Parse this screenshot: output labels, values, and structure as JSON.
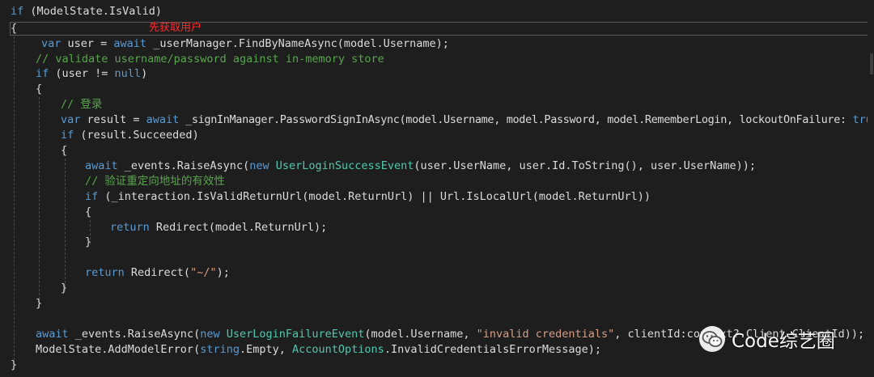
{
  "colors": {
    "background": "#1e1e1e",
    "keyword": "#569cd6",
    "type": "#4ec9b0",
    "comment": "#57a64a",
    "string": "#d69d85",
    "plain": "#dcdcdc",
    "annotation": "#ff2a2a"
  },
  "annotation": "先获取用户",
  "watermark": {
    "icon": "wechat-icon",
    "text": "Code综艺圈"
  },
  "code": {
    "l01": {
      "kw1": "if",
      "rest": " (ModelState.IsValid)"
    },
    "l02": {
      "text": "{"
    },
    "l03": {
      "kw1": "var",
      "mid": " user = ",
      "kw2": "await",
      "rest": " _userManager.FindByNameAsync(model.Username);"
    },
    "l04": {
      "comment": "// validate username/password against in-memory store"
    },
    "l05": {
      "kw1": "if",
      "mid": " (user != ",
      "kw2": "null",
      "rest": ")"
    },
    "l06": {
      "text": "{"
    },
    "l07": {
      "comment": "// 登录"
    },
    "l08": {
      "kw1": "var",
      "mid": " result = ",
      "kw2": "await",
      "mid2": " _signInManager.PasswordSignInAsync(model.Username, model.Password, model.RememberLogin, lockoutOnFailure: ",
      "kw3": "true",
      "rest": ");"
    },
    "l09": {
      "kw1": "if",
      "rest": " (result.Succeeded)"
    },
    "l10": {
      "text": "{"
    },
    "l11": {
      "kw1": "await",
      "mid": " _events.RaiseAsync(",
      "kw2": "new",
      "sp": " ",
      "type": "UserLoginSuccessEvent",
      "rest": "(user.UserName, user.Id.ToString(), user.UserName));"
    },
    "l12": {
      "comment": "// 验证重定向地址的有效性"
    },
    "l13": {
      "kw1": "if",
      "rest": " (_interaction.IsValidReturnUrl(model.ReturnUrl) || Url.IsLocalUrl(model.ReturnUrl))"
    },
    "l14": {
      "text": "{"
    },
    "l15": {
      "kw1": "return",
      "rest": " Redirect(model.ReturnUrl);"
    },
    "l16": {
      "text": "}"
    },
    "l17": {
      "kw1": "return",
      "mid": " Redirect(",
      "str": "\"~/\"",
      "rest": ");"
    },
    "l18": {
      "text": "}"
    },
    "l19": {
      "text": "}"
    },
    "l20": {
      "kw1": "await",
      "mid": " _events.RaiseAsync(",
      "kw2": "new",
      "sp": " ",
      "type": "UserLoginFailureEvent",
      "mid2": "(model.Username, ",
      "str": "\"invalid credentials\"",
      "rest": ", clientId:context?.Client.ClientId));"
    },
    "l21": {
      "mid": "ModelState.AddModelError(",
      "kw1": "string",
      "mid2": ".Empty, ",
      "type": "AccountOptions",
      "rest": ".InvalidCredentialsErrorMessage);"
    },
    "l22": {
      "text": "}"
    }
  }
}
